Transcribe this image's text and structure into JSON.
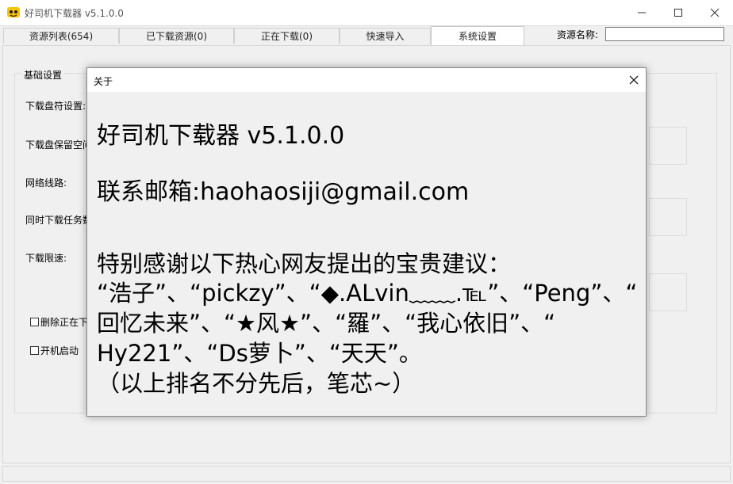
{
  "window": {
    "title": "好司机下载器 v5.1.0.0",
    "minimize_icon": "minimize-icon",
    "maximize_icon": "maximize-icon",
    "close_icon": "close-icon"
  },
  "tabs": [
    {
      "label": "资源列表(654)"
    },
    {
      "label": "已下载资源(0)"
    },
    {
      "label": "正在下载(0)"
    },
    {
      "label": "快速导入"
    },
    {
      "label": "系统设置"
    }
  ],
  "search": {
    "label": "资源名称:",
    "value": ""
  },
  "settings": {
    "group_title": "基础设置",
    "drive_label": "下载盘符设置:",
    "reserve_label": "下载盘保留空间",
    "network_label": "网络线路:",
    "concurrent_label": "同时下载任务数",
    "speed_label": "下载限速:",
    "delete_label": "删除正在下",
    "startup_label": "开机启动"
  },
  "dialog": {
    "title": "关于",
    "app_line": "好司机下载器 v5.1.0.0",
    "email_line": "联系邮箱:haohaosiji@gmail.com",
    "thanks_line1": "特别感谢以下热心网友提出的宝贵建议：",
    "thanks_line2": "“浩子”、“pickzy”、“◆.ALvin﹏﹏.℡”、“Peng”、“",
    "thanks_line3": "回忆未来”、“★风★”、“羅”、“我心依旧”、“",
    "thanks_line4": "Hy221”、“Ds萝卜”、“天天”。",
    "thanks_line5": "（以上排名不分先后，笔芯~）"
  },
  "colors": {
    "window_bg": "#f0f0f0",
    "titlebar_bg": "#ffffff",
    "app_icon": "#f5c400"
  }
}
